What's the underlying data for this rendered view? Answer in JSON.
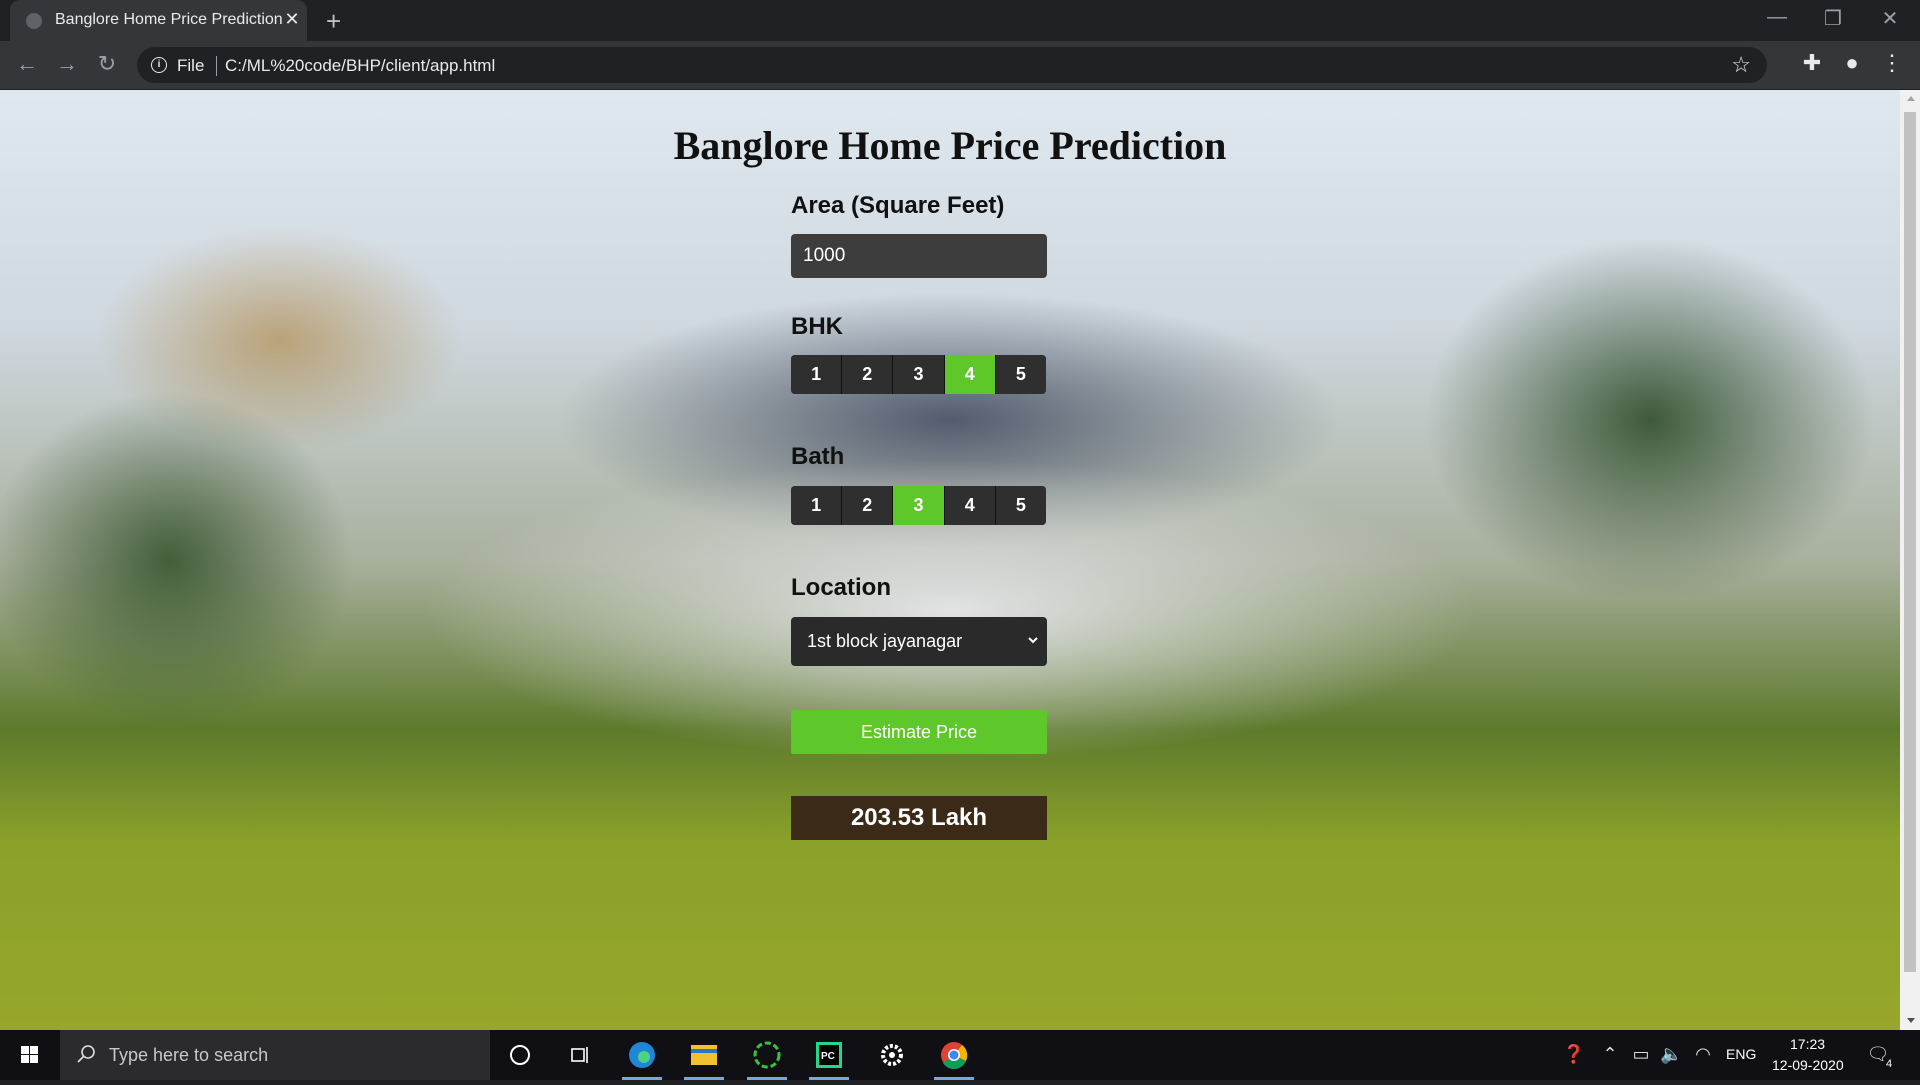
{
  "browser": {
    "tab_title": "Banglore Home Price Prediction",
    "tab_close": "✕",
    "new_tab": "+",
    "url_scheme": "File",
    "url": "C:/ML%20code/BHP/client/app.html"
  },
  "page": {
    "heading": "Banglore Home Price Prediction",
    "area": {
      "label": "Area (Square Feet)",
      "value": "1000"
    },
    "bhk": {
      "label": "BHK",
      "options": [
        "1",
        "2",
        "3",
        "4",
        "5"
      ],
      "selected": "4"
    },
    "bath": {
      "label": "Bath",
      "options": [
        "1",
        "2",
        "3",
        "4",
        "5"
      ],
      "selected": "3"
    },
    "location": {
      "label": "Location",
      "selected": "1st block jayanagar"
    },
    "estimate_button": "Estimate Price",
    "result": "203.53 Lakh",
    "colors": {
      "active_option": "#5ec72a",
      "result_bg": "#3a2a17",
      "option_bg": "#2f2f2f"
    }
  },
  "taskbar": {
    "search_placeholder": "Type here to search",
    "language": "ENG",
    "time": "17:23",
    "date": "12-09-2020",
    "notification_count": "4",
    "apps": [
      "cortana-icon",
      "task-view-icon",
      "edge-icon",
      "file-explorer-icon",
      "refresh-app-icon",
      "pycharm-icon",
      "settings-icon",
      "chrome-icon"
    ]
  }
}
